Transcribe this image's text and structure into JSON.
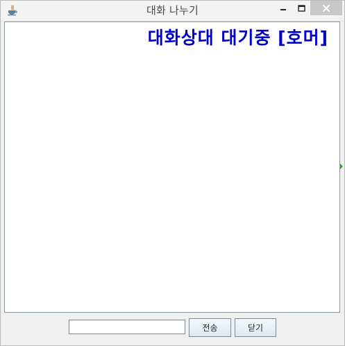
{
  "window": {
    "title": "대화 나누기",
    "controls": {
      "minimize_icon": "minimize-icon",
      "maximize_icon": "maximize-icon",
      "close_icon": "close-icon"
    }
  },
  "chat": {
    "status_text": "대화상대 대기중 [호머]",
    "status_color": "#0000cc",
    "messages": []
  },
  "composer": {
    "input_value": "",
    "send_label": "전송",
    "close_label": "닫기"
  },
  "icons": {
    "app": "java-cup-icon"
  }
}
